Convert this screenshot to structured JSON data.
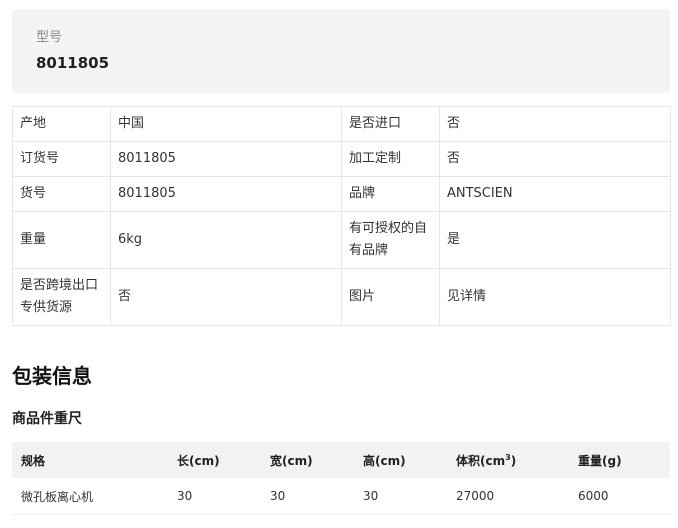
{
  "model": {
    "label": "型号",
    "value": "8011805"
  },
  "attributes": [
    {
      "k1": "产地",
      "v1": "中国",
      "k2": "是否进口",
      "v2": "否"
    },
    {
      "k1": "订货号",
      "v1": "8011805",
      "k2": "加工定制",
      "v2": "否"
    },
    {
      "k1": "货号",
      "v1": "8011805",
      "k2": "品牌",
      "v2": "ANTSCIEN"
    },
    {
      "k1": "重量",
      "v1": "6kg",
      "k2": "有可授权的自有品牌",
      "v2": "是"
    },
    {
      "k1": "是否跨境出口专供货源",
      "v1": "否",
      "k2": "图片",
      "v2": "见详情"
    }
  ],
  "packaging": {
    "title": "包装信息",
    "subtitle": "商品件重尺",
    "headers": {
      "spec": "规格",
      "length": "长(cm)",
      "width": "宽(cm)",
      "height": "高(cm)",
      "volume_prefix": "体积(cm",
      "volume_sup": "3",
      "volume_suffix": ")",
      "weight": "重量(g)"
    },
    "rows": [
      {
        "spec": "微孔板离心机",
        "length": "30",
        "width": "30",
        "height": "30",
        "volume": "27000",
        "weight": "6000"
      }
    ]
  }
}
